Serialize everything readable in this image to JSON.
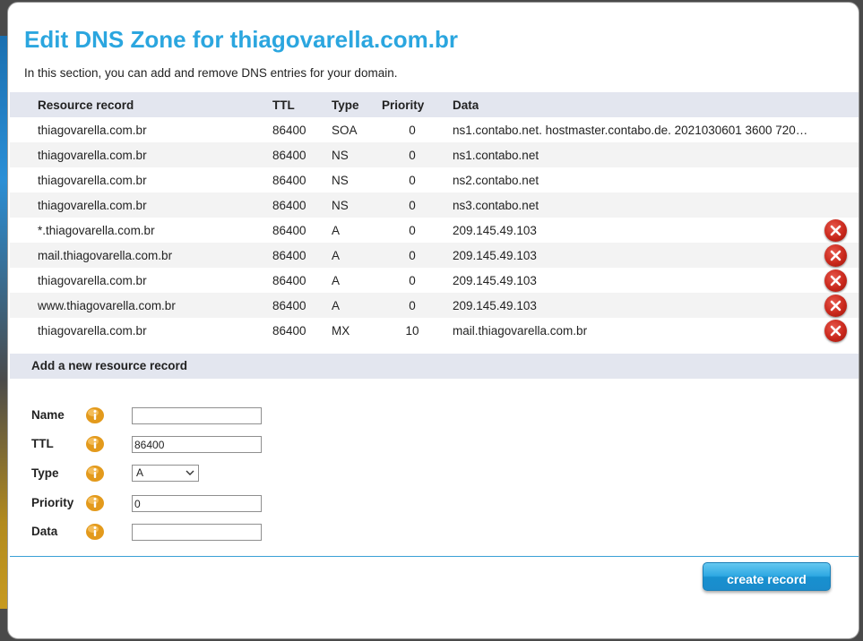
{
  "page": {
    "title": "Edit DNS Zone for thiagovarella.com.br",
    "intro": "In this section, you can add and remove DNS entries for your domain."
  },
  "table": {
    "headers": {
      "name": "Resource record",
      "ttl": "TTL",
      "type": "Type",
      "priority": "Priority",
      "data": "Data"
    },
    "rows": [
      {
        "name": "thiagovarella.com.br",
        "ttl": "86400",
        "type": "SOA",
        "priority": "0",
        "data": "ns1.contabo.net. hostmaster.contabo.de. 2021030601 3600 720…",
        "deletable": false
      },
      {
        "name": "thiagovarella.com.br",
        "ttl": "86400",
        "type": "NS",
        "priority": "0",
        "data": "ns1.contabo.net",
        "deletable": false
      },
      {
        "name": "thiagovarella.com.br",
        "ttl": "86400",
        "type": "NS",
        "priority": "0",
        "data": "ns2.contabo.net",
        "deletable": false
      },
      {
        "name": "thiagovarella.com.br",
        "ttl": "86400",
        "type": "NS",
        "priority": "0",
        "data": "ns3.contabo.net",
        "deletable": false
      },
      {
        "name": "*.thiagovarella.com.br",
        "ttl": "86400",
        "type": "A",
        "priority": "0",
        "data": "209.145.49.103",
        "deletable": true
      },
      {
        "name": "mail.thiagovarella.com.br",
        "ttl": "86400",
        "type": "A",
        "priority": "0",
        "data": "209.145.49.103",
        "deletable": true
      },
      {
        "name": "thiagovarella.com.br",
        "ttl": "86400",
        "type": "A",
        "priority": "0",
        "data": "209.145.49.103",
        "deletable": true
      },
      {
        "name": "www.thiagovarella.com.br",
        "ttl": "86400",
        "type": "A",
        "priority": "0",
        "data": "209.145.49.103",
        "deletable": true
      },
      {
        "name": "thiagovarella.com.br",
        "ttl": "86400",
        "type": "MX",
        "priority": "10",
        "data": "mail.thiagovarella.com.br",
        "deletable": true
      }
    ]
  },
  "add_form": {
    "section_title": "Add a new resource record",
    "name": {
      "label": "Name",
      "value": ""
    },
    "ttl": {
      "label": "TTL",
      "value": "86400"
    },
    "type": {
      "label": "Type",
      "value": "A"
    },
    "priority": {
      "label": "Priority",
      "value": "0"
    },
    "data": {
      "label": "Data",
      "value": ""
    },
    "submit_label": "create record"
  },
  "colors": {
    "title": "#2ba6df",
    "header_bg": "#e3e6ef",
    "delete": "#c9281c",
    "button": "#2ea8e2",
    "info_icon": "#e39a1c"
  },
  "icons": {
    "delete": "delete-x-icon",
    "info": "info-icon",
    "select": "chevron-down-icon"
  }
}
